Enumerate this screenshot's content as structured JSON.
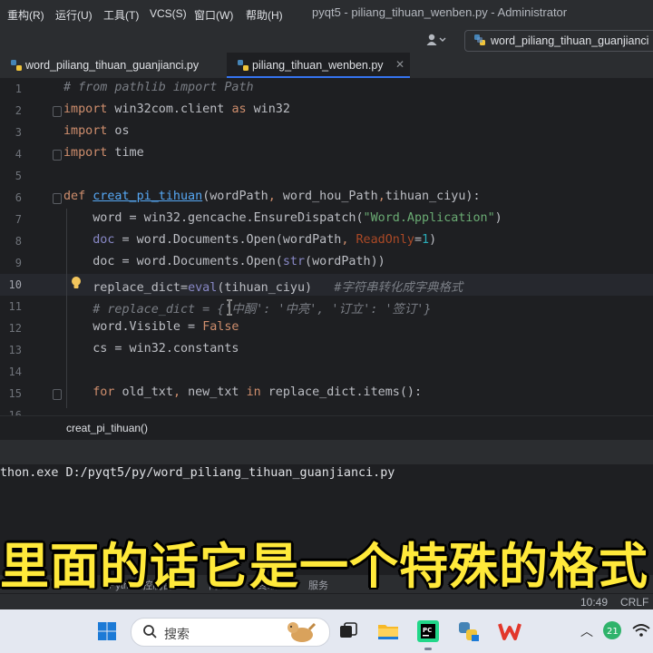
{
  "menubar": {
    "items": [
      "重构(R)",
      "运行(U)",
      "工具(T)",
      "VCS(S)",
      "窗口(W)",
      "帮助(H)"
    ],
    "window_title": "pyqt5 - piliang_tihuan_wenben.py - Administrator"
  },
  "toolbar": {
    "run_config": "word_piliang_tihuan_guanjianci"
  },
  "tabs": [
    {
      "label": "word_piliang_tihuan_guanjianci.py",
      "active": false
    },
    {
      "label": "piliang_tihuan_wenben.py",
      "active": true
    }
  ],
  "editor": {
    "line_numbers": [
      "1",
      "2",
      "3",
      "4",
      "5",
      "6",
      "7",
      "8",
      "9",
      "10",
      "11",
      "12",
      "13",
      "14",
      "15",
      "16"
    ],
    "current_line": "10",
    "lines": [
      [
        {
          "t": "# from pathlib import Path",
          "c": "c"
        }
      ],
      [
        {
          "t": "import",
          "c": "k"
        },
        {
          "t": " win32com.client ",
          "c": ""
        },
        {
          "t": "as",
          "c": "k"
        },
        {
          "t": " win32",
          "c": ""
        }
      ],
      [
        {
          "t": "import",
          "c": "k"
        },
        {
          "t": " os",
          "c": ""
        }
      ],
      [
        {
          "t": "import",
          "c": "k"
        },
        {
          "t": " time",
          "c": ""
        }
      ],
      [],
      [
        {
          "t": "def",
          "c": "k"
        },
        {
          "t": " ",
          "c": ""
        },
        {
          "t": "creat_pi_tihuan",
          "c": "fn"
        },
        {
          "t": "(wordPath",
          "c": ""
        },
        {
          "t": ", ",
          "c": "k"
        },
        {
          "t": "word_hou_Path",
          "c": ""
        },
        {
          "t": ",",
          "c": "k"
        },
        {
          "t": "tihuan_ciyu):",
          "c": ""
        }
      ],
      [
        {
          "t": "    word = win32.gencache.EnsureDispatch(",
          "c": ""
        },
        {
          "t": "\"Word.Application\"",
          "c": "s"
        },
        {
          "t": ")",
          "c": ""
        }
      ],
      [
        {
          "t": "    ",
          "c": ""
        },
        {
          "t": "doc",
          "c": "b"
        },
        {
          "t": " = word.Documents.Open(wordPath",
          "c": ""
        },
        {
          "t": ", ",
          "c": "k"
        },
        {
          "t": "ReadOnly",
          "c": "p"
        },
        {
          "t": "=",
          "c": ""
        },
        {
          "t": "1",
          "c": "n"
        },
        {
          "t": ")",
          "c": ""
        }
      ],
      [
        {
          "t": "    doc = word.Documents.Open(",
          "c": ""
        },
        {
          "t": "str",
          "c": "b"
        },
        {
          "t": "(wordPath))",
          "c": ""
        }
      ],
      [
        {
          "t": "    replace_dict=",
          "c": ""
        },
        {
          "t": "eval",
          "c": "b"
        },
        {
          "t": "(tihuan_ciyu)   ",
          "c": ""
        },
        {
          "t": "#字符串转化成字典格式",
          "c": "c"
        }
      ],
      [
        {
          "t": "    # replace_dict = {'中酮': '中亮', '订立': '签订'}",
          "c": "c"
        }
      ],
      [
        {
          "t": "    word.Visible = ",
          "c": ""
        },
        {
          "t": "False",
          "c": "k"
        }
      ],
      [
        {
          "t": "    cs = win32.constants",
          "c": ""
        }
      ],
      [],
      [
        {
          "t": "    ",
          "c": ""
        },
        {
          "t": "for",
          "c": "k"
        },
        {
          "t": " old_txt",
          "c": ""
        },
        {
          "t": ", ",
          "c": "k"
        },
        {
          "t": "new_txt ",
          "c": ""
        },
        {
          "t": "in",
          "c": "k"
        },
        {
          "t": " replace_dict.items():",
          "c": ""
        }
      ],
      []
    ]
  },
  "breadcrumb": "creat_pi_tihuan()",
  "console": {
    "line": "thon.exe D:/pyqt5/py/word_piliang_tihuan_guanjianci.py"
  },
  "subtitle": "里面的话它是一个特殊的格式",
  "tool_strip": {
    "items": [
      "gs",
      "TODO",
      "Python 控制台",
      "问题",
      "终端",
      "服务"
    ]
  },
  "status": {
    "position": "10:49",
    "line_ending": "CRLF"
  },
  "taskbar": {
    "search_label": "搜索",
    "tray_badge": "21"
  }
}
